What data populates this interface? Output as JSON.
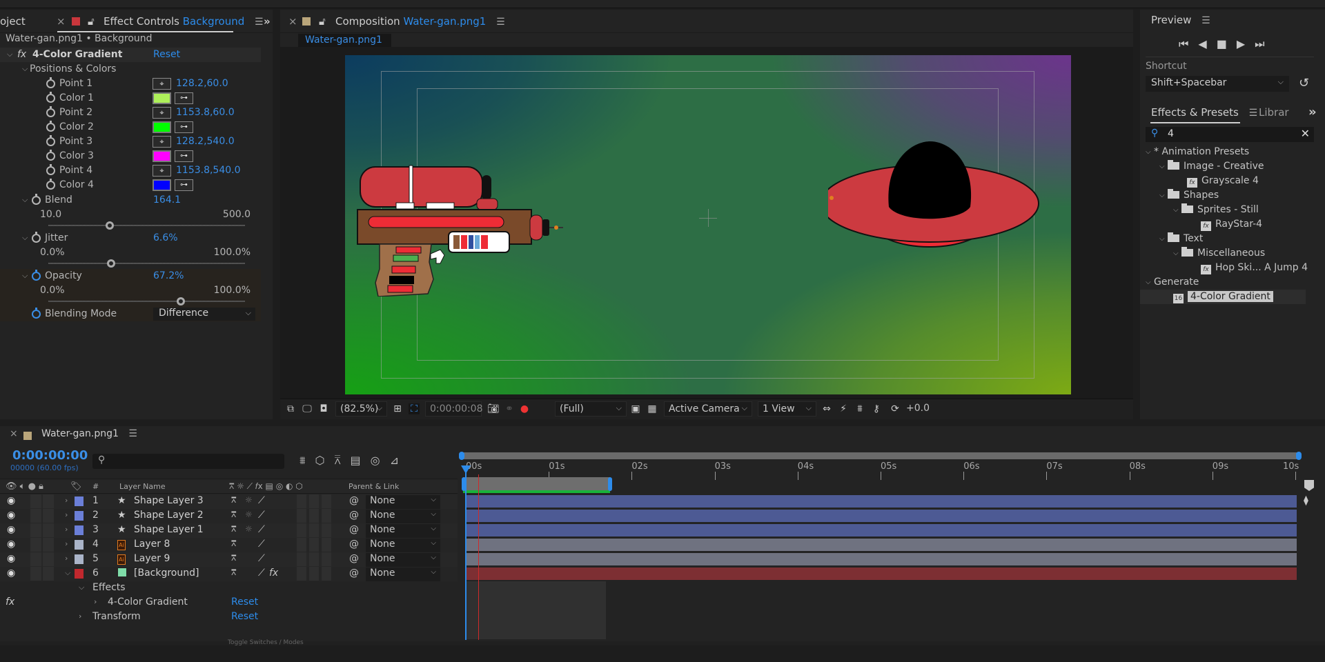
{
  "effect_controls": {
    "project_tab": "oject",
    "tab_label": "Effect Controls",
    "tab_layer": "Background",
    "breadcrumb": "Water-gan.png1 • Background",
    "effect_name": "4-Color Gradient",
    "reset_label": "Reset",
    "group_label": "Positions & Colors",
    "points": [
      {
        "label": "Point 1",
        "value": "128.2,60.0"
      },
      {
        "label": "Point 2",
        "value": "1153.8,60.0"
      },
      {
        "label": "Point 3",
        "value": "128.2,540.0"
      },
      {
        "label": "Point 4",
        "value": "1153.8,540.0"
      }
    ],
    "colors": [
      {
        "label": "Color 1",
        "hex": "#aef05a"
      },
      {
        "label": "Color 2",
        "hex": "#00ff00"
      },
      {
        "label": "Color 3",
        "hex": "#ff00ff"
      },
      {
        "label": "Color 4",
        "hex": "#0000ff"
      }
    ],
    "blend": {
      "label": "Blend",
      "value": "164.1",
      "min": "10.0",
      "max": "500.0",
      "fraction": 0.314
    },
    "jitter": {
      "label": "Jitter",
      "value": "6.6%",
      "min": "0.0%",
      "max": "100.0%",
      "fraction": 0.32
    },
    "opacity": {
      "label": "Opacity",
      "value": "67.2%",
      "min": "0.0%",
      "max": "100.0%",
      "fraction": 0.672
    },
    "blending_mode": {
      "label": "Blending Mode",
      "value": "Difference"
    }
  },
  "composition": {
    "tab_label": "Composition",
    "tab_comp": "Water-gan.png1",
    "subtab": "Water-gan.png1",
    "toolbar": {
      "zoom": "(82.5%)",
      "timecode": "0:00:00:08",
      "resolution": "(Full)",
      "camera": "Active Camera",
      "views": "1 View",
      "exposure": "+0.0"
    }
  },
  "preview": {
    "title": "Preview",
    "shortcut_label": "Shortcut",
    "shortcut_value": "Shift+Spacebar"
  },
  "effects_presets": {
    "tab_label": "Effects & Presets",
    "tab2_label": "Librar",
    "search_value": "4",
    "tree": [
      {
        "label": "* Animation Presets",
        "type": "category",
        "depth": 0
      },
      {
        "label": "Image - Creative",
        "type": "folder",
        "depth": 1
      },
      {
        "label": "Grayscale 4",
        "type": "preset",
        "depth": 2
      },
      {
        "label": "Shapes",
        "type": "folder",
        "depth": 1
      },
      {
        "label": "Sprites - Still",
        "type": "folder",
        "depth": 2
      },
      {
        "label": "RayStar-4",
        "type": "preset",
        "depth": 3
      },
      {
        "label": "Text",
        "type": "folder",
        "depth": 1
      },
      {
        "label": "Miscellaneous",
        "type": "folder",
        "depth": 2
      },
      {
        "label": "Hop Ski... A Jump 4",
        "type": "preset",
        "depth": 3
      },
      {
        "label": "Generate",
        "type": "category",
        "depth": 0
      },
      {
        "label": "4-Color Gradient",
        "type": "effect",
        "depth": 1,
        "selected": true
      }
    ]
  },
  "timeline": {
    "tab_label": "Water-gan.png1",
    "timecode": "0:00:00:00",
    "frame_info": "00000 (60.00 fps)",
    "col_hash": "#",
    "col_layer_name": "Layer Name",
    "col_parent": "Parent & Link",
    "ruler": [
      "00s",
      "01s",
      "02s",
      "03s",
      "04s",
      "05s",
      "06s",
      "07s",
      "08s",
      "09s",
      "10s"
    ],
    "layers": [
      {
        "num": "1",
        "name": "Shape Layer 3",
        "type": "shape",
        "label_color": "#6b7fd8",
        "parent": "None",
        "bar_color": "#4d5a94"
      },
      {
        "num": "2",
        "name": "Shape Layer 2",
        "type": "shape",
        "label_color": "#6b7fd8",
        "parent": "None",
        "bar_color": "#4d5a94"
      },
      {
        "num": "3",
        "name": "Shape Layer 1",
        "type": "shape",
        "label_color": "#6b7fd8",
        "parent": "None",
        "bar_color": "#4d5a94"
      },
      {
        "num": "4",
        "name": "Layer 8",
        "type": "ai",
        "label_color": "#aab4c8",
        "parent": "None",
        "bar_color": "#6f7280"
      },
      {
        "num": "5",
        "name": "Layer 9",
        "type": "ai",
        "label_color": "#aab4c8",
        "parent": "None",
        "bar_color": "#6f7280"
      },
      {
        "num": "6",
        "name": "[Background]",
        "type": "solid",
        "label_color": "#c0282e",
        "parent": "None",
        "bar_color": "#7d2f33"
      }
    ],
    "effects_label": "Effects",
    "effect_item": "4-Color Gradient",
    "transform_label": "Transform",
    "reset_label": "Reset",
    "bottom_toggle": "Toggle Switches / Modes"
  }
}
